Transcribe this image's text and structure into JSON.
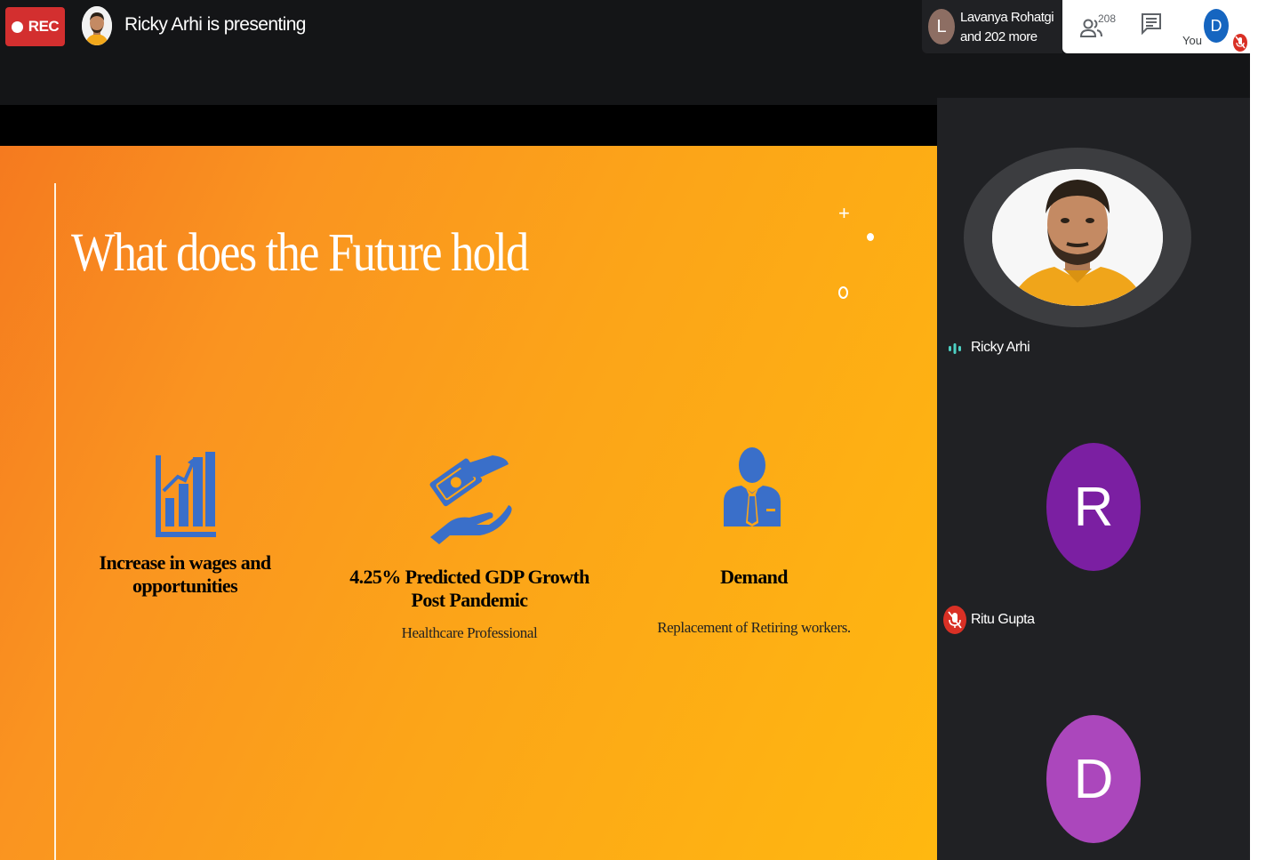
{
  "topbar": {
    "rec_label": "REC",
    "presenting_text": "Ricky Arhi is presenting",
    "others": {
      "avatar_letter": "L",
      "line1": "Lavanya Rohatgi",
      "line2": "and 202 more"
    },
    "people_count": "208",
    "you_letter": "D",
    "you_label": "You"
  },
  "slide": {
    "title": "What does the Future hold",
    "features": [
      {
        "heading_line1": "Increase in wages and",
        "heading_line2": "opportunities",
        "sub": "",
        "icon": "bar-chart-growth-icon"
      },
      {
        "heading_line1": "4.25% Predicted GDP Growth",
        "heading_line2": "Post Pandemic",
        "sub": "Healthcare Professional",
        "icon": "money-hand-icon"
      },
      {
        "heading_line1": "Demand",
        "heading_line2": "",
        "sub": "Replacement of Retiring workers.",
        "icon": "businessman-icon"
      }
    ]
  },
  "participants": [
    {
      "name": "Ricky Arhi",
      "state": "speaking"
    },
    {
      "name": "Ritu Gupta",
      "letter": "R",
      "color": "#7b1fa2",
      "state": "muted"
    },
    {
      "letter": "D",
      "color": "#ab47bc"
    }
  ],
  "colors": {
    "rec": "#d32f2f",
    "slide_orange": "#fca518",
    "icon_blue": "#3a6fc9",
    "muted_red": "#d93025"
  }
}
